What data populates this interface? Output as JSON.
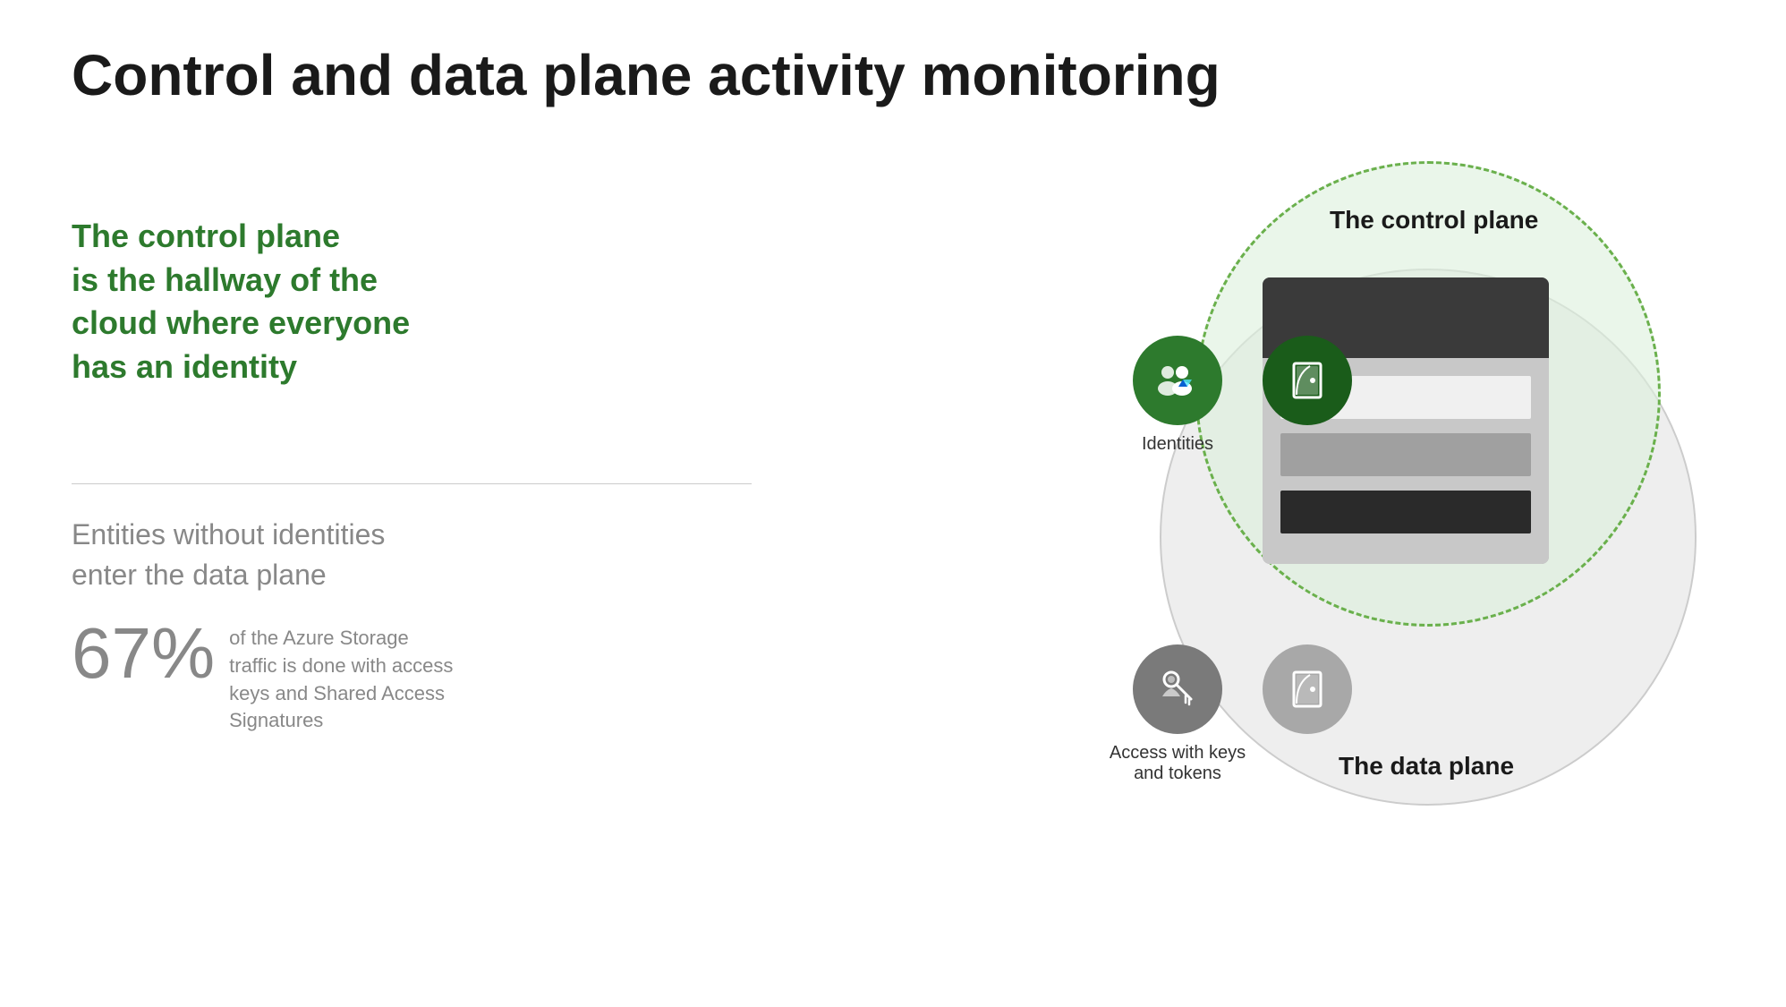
{
  "page": {
    "title": "Control and data plane activity monitoring",
    "background": "#ffffff"
  },
  "left": {
    "control_plane_heading": "The control plane\nis the hallway of the\ncloud where everyone\nhas an identity",
    "entities_text": "Entities without identities\nenter the data plane",
    "stat": {
      "number": "67%",
      "description": "of the Azure Storage traffic is done with access keys and Shared Access Signatures"
    }
  },
  "diagram": {
    "control_plane_label": "The control plane",
    "data_plane_label": "The data plane",
    "identities_label": "Identities",
    "access_label": "Access with keys\nand tokens"
  },
  "colors": {
    "green": "#2d7a2d",
    "dark_green": "#1a5c1a",
    "light_green_bg": "rgba(220,240,220,0.6)",
    "green_dashed": "#6ab04c",
    "gray_circle": "#eeeeee",
    "title_black": "#1a1a1a",
    "text_gray": "#888888"
  }
}
